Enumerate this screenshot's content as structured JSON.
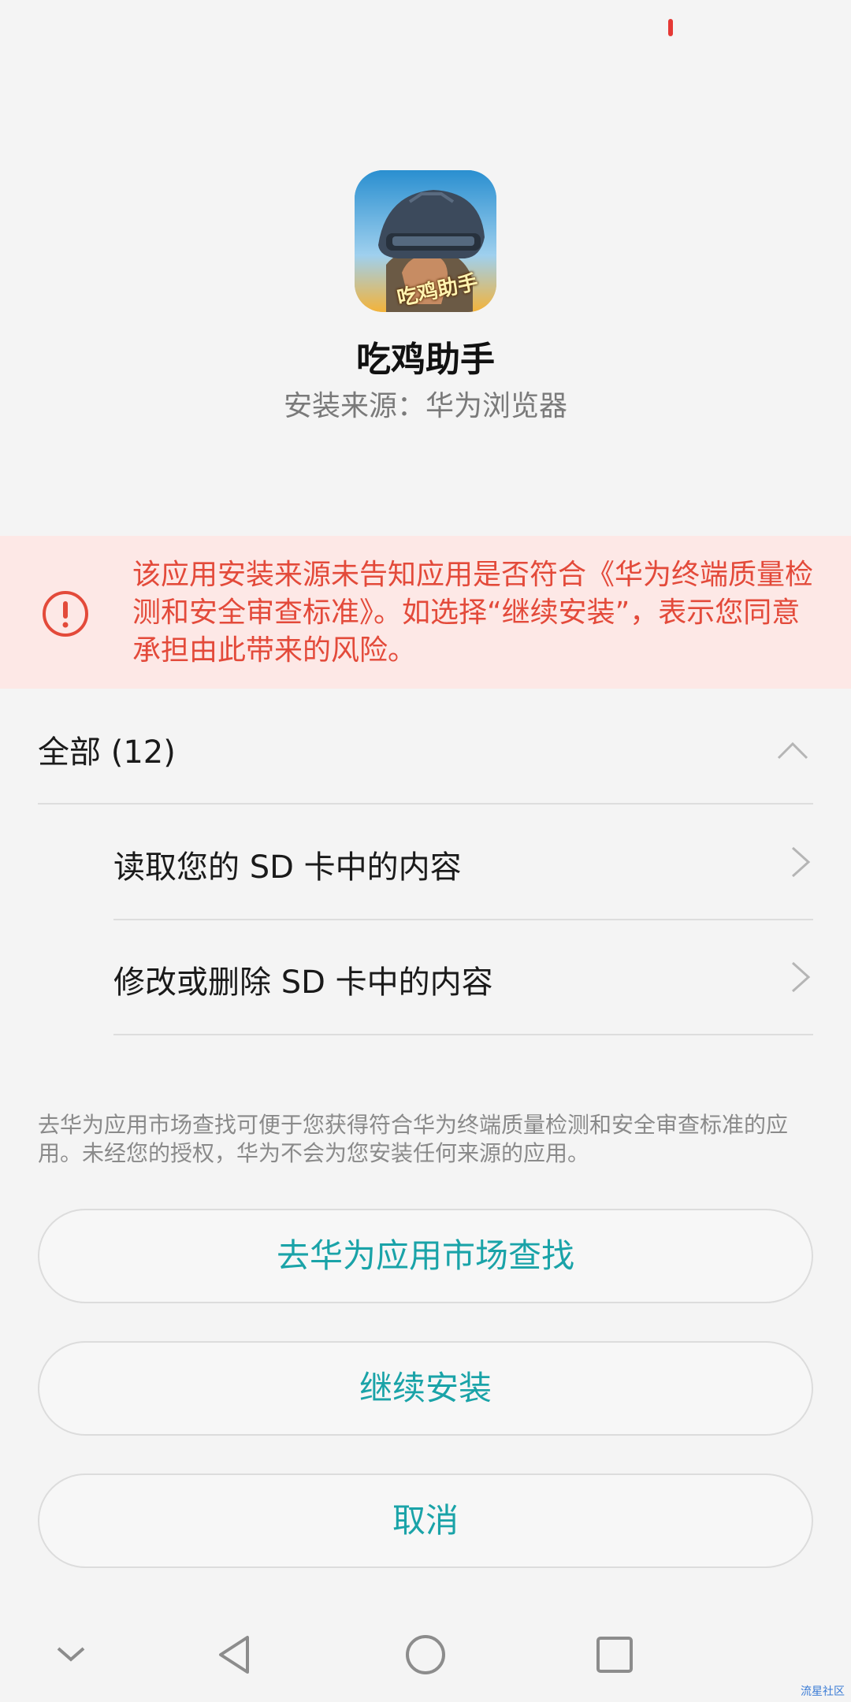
{
  "status_bar": {
    "left_text": "",
    "right_text": "",
    "indicator_color": "#e53935"
  },
  "app": {
    "name": "吃鸡助手",
    "icon_badge_text": "吃鸡助手",
    "install_source": "安装来源：华为浏览器"
  },
  "warning": {
    "icon": "alert-circle-icon",
    "color": "#e34a3a",
    "text": "该应用安装来源未告知应用是否符合《华为终端质量检测和安全审查标准》。如选择“继续安装”，表示您同意承担由此带来的风险。"
  },
  "permissions": {
    "header_label": "全部 (12)",
    "expanded": true,
    "items": [
      {
        "label": "读取您的 SD 卡中的内容"
      },
      {
        "label": "修改或删除 SD 卡中的内容"
      }
    ]
  },
  "note": "去华为应用市场查找可便于您获得符合华为终端质量检测和安全审查标准的应用。未经您的授权，华为不会为您安装任何来源的应用。",
  "buttons": {
    "market_label": "去华为应用市场查找",
    "continue_label": "继续安装",
    "cancel_label": "取消",
    "accent_color": "#1aa3a8"
  },
  "nav_bar": {
    "icons": [
      "chevron-down-icon",
      "back-triangle-icon",
      "home-circle-icon",
      "recents-square-icon"
    ]
  },
  "watermark": "流星社区"
}
